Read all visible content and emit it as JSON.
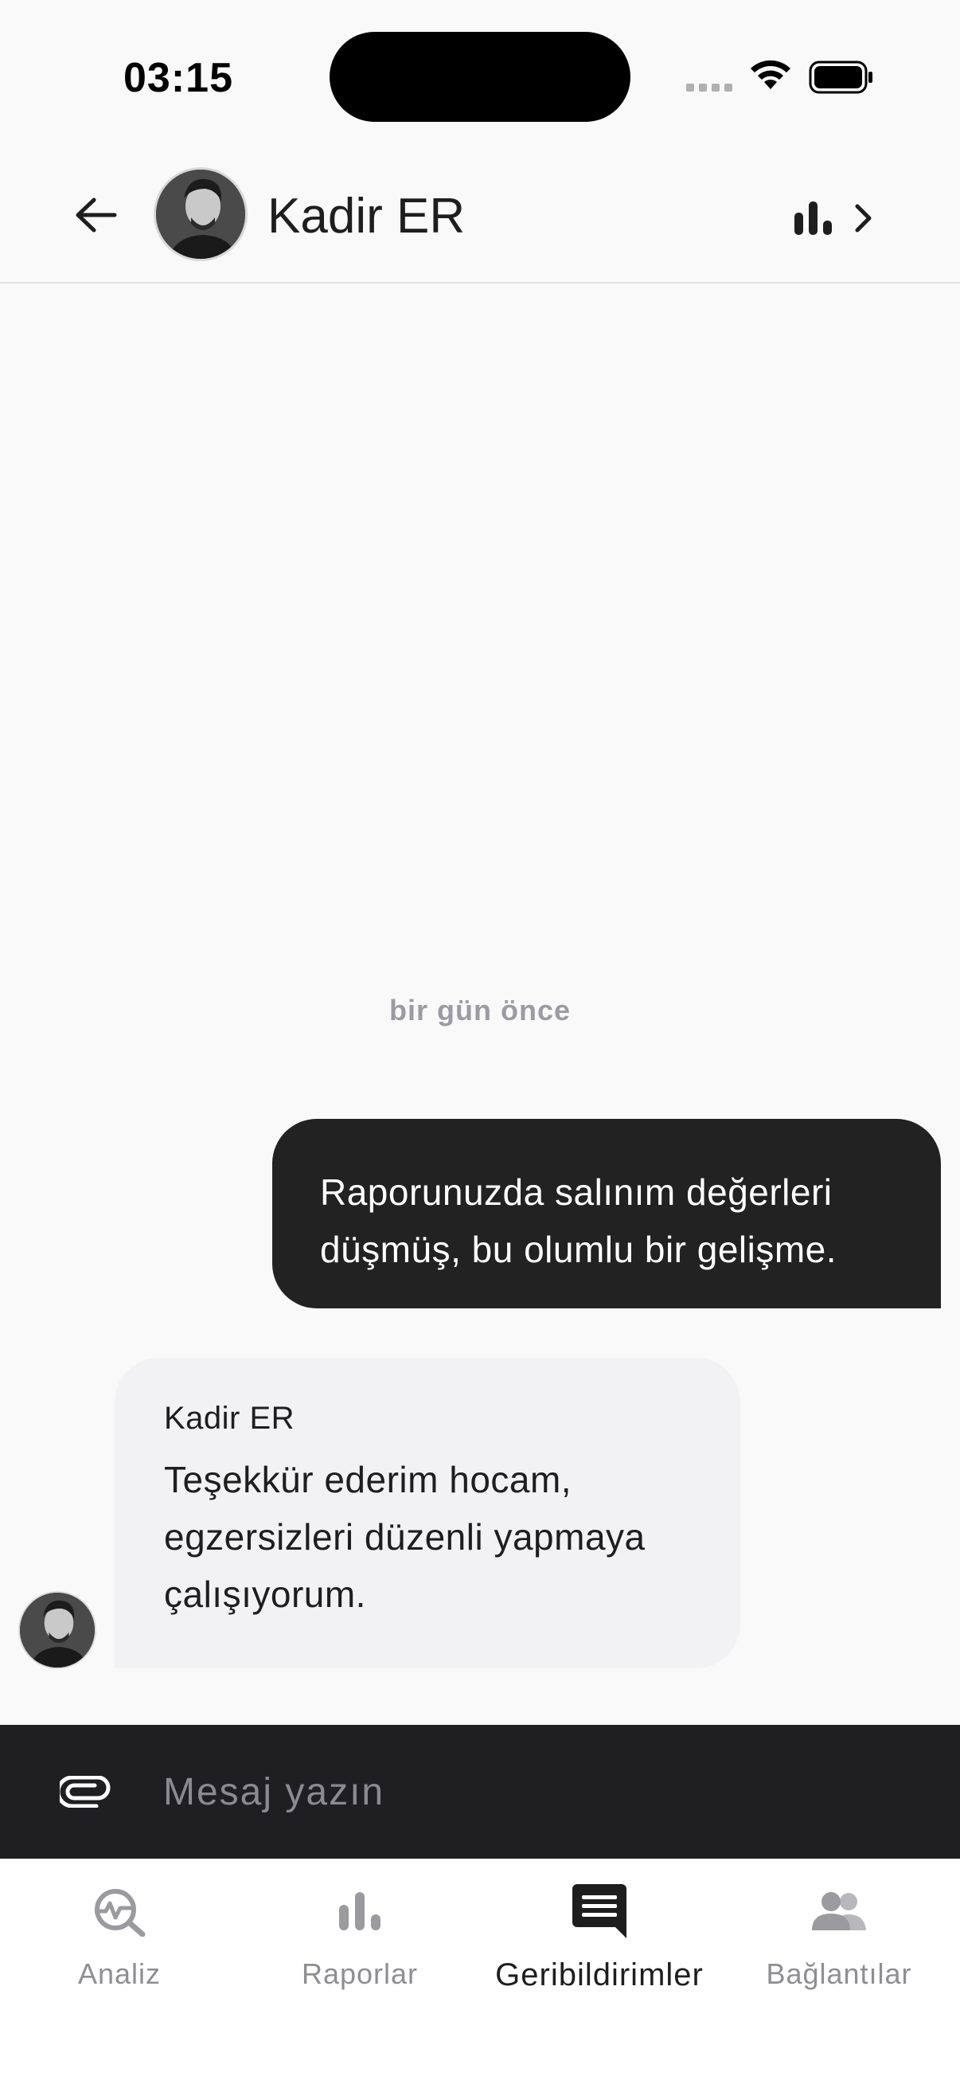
{
  "status_bar": {
    "time": "03:15"
  },
  "header": {
    "contact_name": "Kadir ER",
    "back_icon": "arrow-left-icon",
    "stats_icon": "bar-chart-icon",
    "chevron_icon": "chevron-right-icon"
  },
  "chat": {
    "timestamp": "bir gün önce",
    "messages": [
      {
        "direction": "sent",
        "lines": [
          "Raporunuzda salınım değerleri",
          "düşmüş, bu olumlu bir gelişme."
        ]
      },
      {
        "direction": "received",
        "sender": "Kadir ER",
        "lines": [
          "Teşekkür ederim hocam,",
          "egzersizleri düzenli yapmaya",
          "çalışıyorum."
        ]
      }
    ]
  },
  "input": {
    "placeholder": "Mesaj yazın",
    "value": "",
    "attach_icon": "paperclip-icon"
  },
  "bottom_nav": {
    "items": [
      {
        "label": "Analiz",
        "icon": "analysis-search-icon",
        "active": false
      },
      {
        "label": "Raporlar",
        "icon": "bar-chart-icon",
        "active": false
      },
      {
        "label": "Geribildirimler",
        "icon": "chat-bubble-icon",
        "active": true
      },
      {
        "label": "Bağlantılar",
        "icon": "people-icon",
        "active": false
      }
    ]
  },
  "colors": {
    "background": "#f9f9f9",
    "sent_bubble": "#222222",
    "received_bubble": "#f2f2f4",
    "input_bar": "#1f1f22",
    "muted_text": "#9b9ba3"
  }
}
